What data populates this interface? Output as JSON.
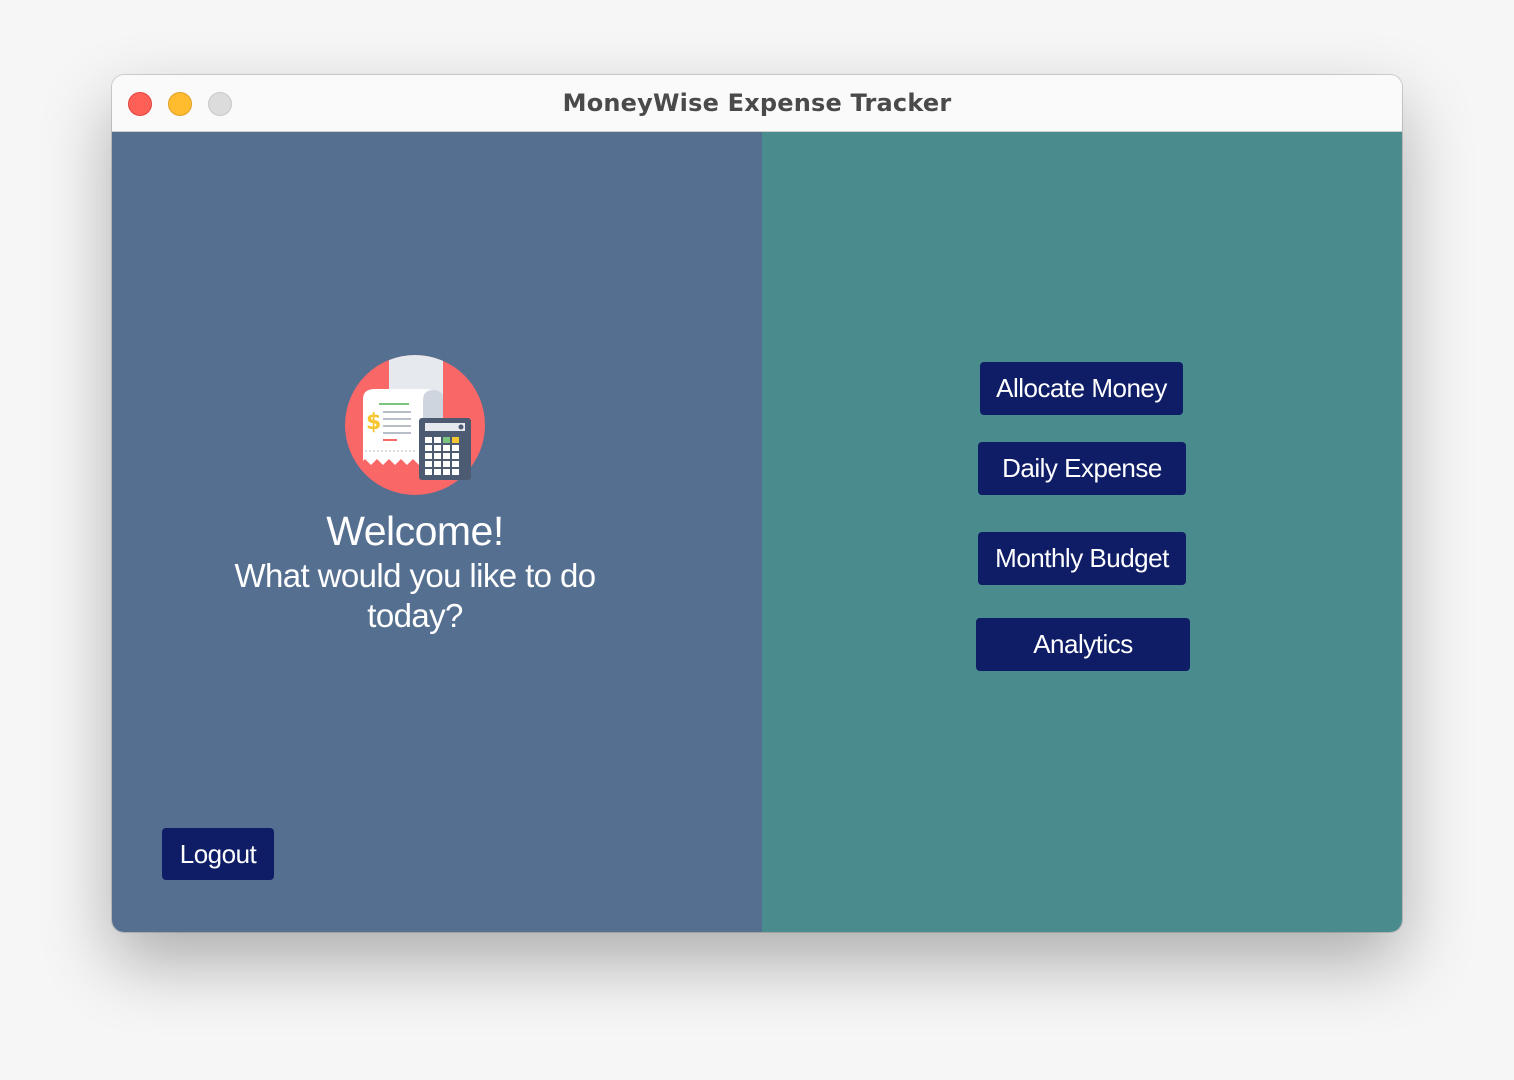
{
  "window": {
    "title": "MoneyWise Expense Tracker"
  },
  "welcome": {
    "heading": "Welcome!",
    "prompt": "What would you like to do today?",
    "logo_icon": "receipt-calculator-icon"
  },
  "actions": {
    "allocate_money": "Allocate Money",
    "daily_expense": "Daily Expense",
    "monthly_budget": "Monthly Budget",
    "analytics": "Analytics",
    "logout": "Logout"
  },
  "colors": {
    "left_panel": "#556f91",
    "right_panel": "#4a8b8e",
    "button": "#0f1d66",
    "logo_circle": "#fa6767"
  }
}
